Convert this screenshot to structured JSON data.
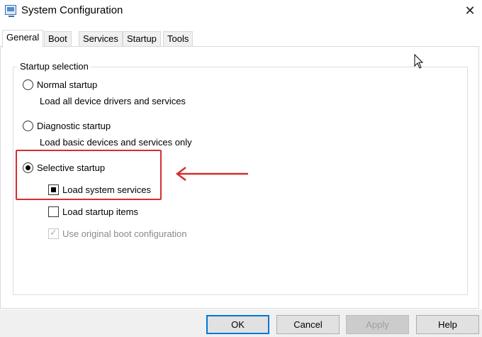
{
  "window": {
    "title": "System Configuration",
    "app_icon": "system-config-icon",
    "close_glyph": "✕"
  },
  "tabs": [
    {
      "label": "General",
      "active": true
    },
    {
      "label": "Boot",
      "active": false
    },
    {
      "label": "Services",
      "active": false
    },
    {
      "label": "Startup",
      "active": false
    },
    {
      "label": "Tools",
      "active": false
    }
  ],
  "startup_selection": {
    "group_title": "Startup selection",
    "normal": {
      "label": "Normal startup",
      "description": "Load all device drivers and services",
      "selected": false
    },
    "diagnostic": {
      "label": "Diagnostic startup",
      "description": "Load basic devices and services only",
      "selected": false
    },
    "selective": {
      "label": "Selective startup",
      "selected": true,
      "options": {
        "load_system_services": {
          "label": "Load system services",
          "state": "indeterminate"
        },
        "load_startup_items": {
          "label": "Load startup items",
          "state": "unchecked"
        },
        "use_original_boot_config": {
          "label": "Use original boot configuration",
          "state": "checked-disabled"
        }
      }
    }
  },
  "annotation": {
    "highlight_color": "#d32f2f",
    "arrow_color": "#d32f2f"
  },
  "buttons": {
    "ok": "OK",
    "cancel": "Cancel",
    "apply": "Apply",
    "help": "Help"
  },
  "colors": {
    "accent": "#0078d7",
    "footer_bg": "#f0f0f0"
  }
}
